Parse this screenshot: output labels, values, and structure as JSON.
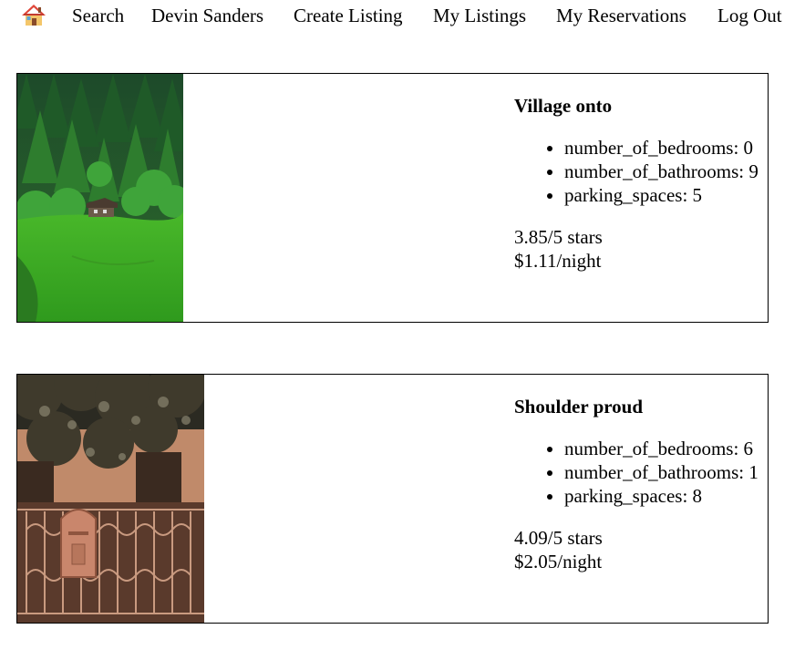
{
  "nav": {
    "home_icon": "house-icon",
    "items": [
      {
        "label": "Search"
      },
      {
        "label": "Devin Sanders"
      },
      {
        "label": "Create Listing"
      },
      {
        "label": "My Listings"
      },
      {
        "label": "My Reservations"
      },
      {
        "label": "Log Out"
      }
    ]
  },
  "listings": [
    {
      "title": "Village onto",
      "features": [
        "number_of_bedrooms: 0",
        "number_of_bathrooms: 9",
        "parking_spaces: 5"
      ],
      "rating": "3.85/5 stars",
      "price": "$1.11/night",
      "image_description_icon": "forest-cabin-photo"
    },
    {
      "title": "Shoulder proud",
      "features": [
        "number_of_bedrooms: 6",
        "number_of_bathrooms: 1",
        "parking_spaces: 8"
      ],
      "rating": "4.09/5 stars",
      "price": "$2.05/night",
      "image_description_icon": "mailbox-gate-photo"
    }
  ]
}
